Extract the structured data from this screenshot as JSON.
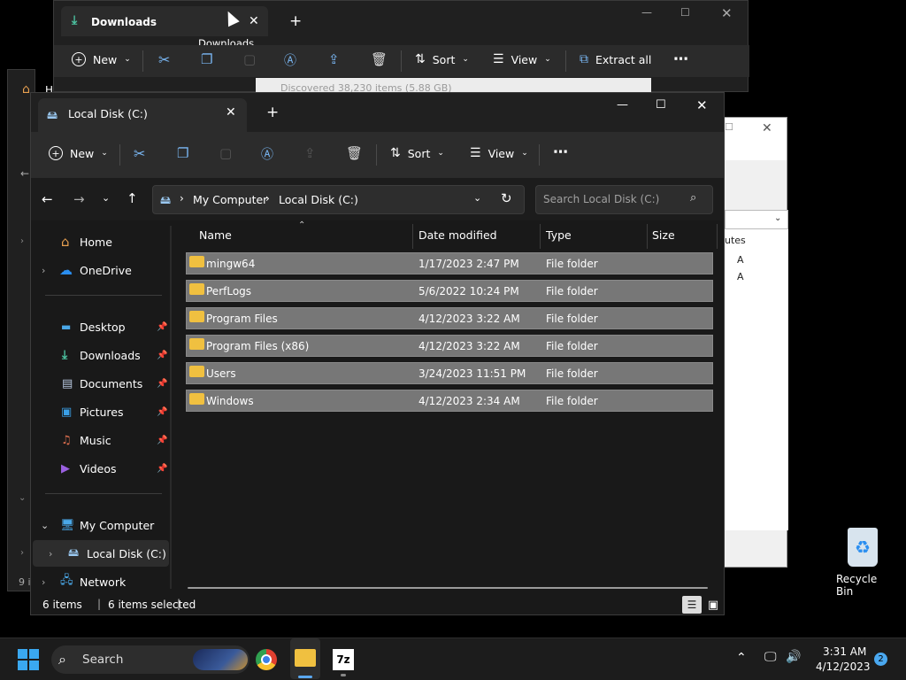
{
  "downloads_window": {
    "tab_title": "Downloads",
    "tooltip": "Downloads",
    "toolbar": {
      "new_label": "New",
      "sort_label": "Sort",
      "view_label": "View",
      "extract_label": "Extract all"
    }
  },
  "progress_dialog": {
    "text": "Discovered 38,230 items (5.88 GB)"
  },
  "props_window": {
    "column_fragment": "utes",
    "values": [
      "A",
      "A"
    ]
  },
  "home_window": {
    "partial_title": "H",
    "status_fragment": "9 i"
  },
  "main_window": {
    "tab_title": "Local Disk (C:)",
    "toolbar": {
      "new_label": "New",
      "sort_label": "Sort",
      "view_label": "View"
    },
    "breadcrumb": [
      "My Computer",
      "Local Disk (C:)"
    ],
    "search_placeholder": "Search Local Disk (C:)",
    "nav": {
      "home": "Home",
      "onedrive": "OneDrive",
      "desktop": "Desktop",
      "downloads": "Downloads",
      "documents": "Documents",
      "pictures": "Pictures",
      "music": "Music",
      "videos": "Videos",
      "my_computer": "My Computer",
      "local_disk": "Local Disk (C:)",
      "network": "Network"
    },
    "columns": {
      "name": "Name",
      "date": "Date modified",
      "type": "Type",
      "size": "Size"
    },
    "rows": [
      {
        "name": "mingw64",
        "date": "1/17/2023 2:47 PM",
        "type": "File folder"
      },
      {
        "name": "PerfLogs",
        "date": "5/6/2022 10:24 PM",
        "type": "File folder"
      },
      {
        "name": "Program Files",
        "date": "4/12/2023 3:22 AM",
        "type": "File folder"
      },
      {
        "name": "Program Files (x86)",
        "date": "4/12/2023 3:22 AM",
        "type": "File folder"
      },
      {
        "name": "Users",
        "date": "3/24/2023 11:51 PM",
        "type": "File folder"
      },
      {
        "name": "Windows",
        "date": "4/12/2023 2:34 AM",
        "type": "File folder"
      }
    ],
    "status": {
      "count": "6 items",
      "selected": "6 items selected"
    }
  },
  "desktop": {
    "recycle_bin": "Recycle Bin"
  },
  "taskbar": {
    "search_label": "Search",
    "time": "3:31 AM",
    "date": "4/12/2023",
    "notification_count": "2",
    "sevenzip_label": "7z"
  },
  "colors": {
    "accent": "#0078d4",
    "folder": "#f0c040",
    "selected_row": "#777777"
  }
}
